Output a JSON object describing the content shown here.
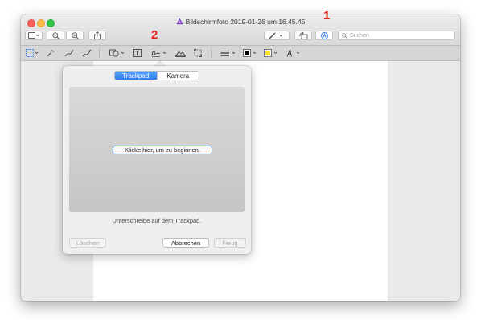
{
  "window": {
    "title": "Bildschirmfoto 2019-01-26 um 16.45.45"
  },
  "toolbar": {
    "search_placeholder": "Suchen"
  },
  "callouts": {
    "one": "1",
    "two": "2"
  },
  "signature_popover": {
    "tabs": [
      {
        "label": "Trackpad",
        "selected": true
      },
      {
        "label": "Kamera",
        "selected": false
      }
    ],
    "click_prompt": "Klicke hier, um zu beginnen.",
    "hint": "Unterschreibe auf dem Trackpad.",
    "buttons": {
      "clear": "Löschen",
      "cancel": "Abbrechen",
      "done": "Fertig"
    }
  },
  "colors": {
    "accent": "#2e7bf0",
    "callout": "#e8241b",
    "highlight_color": "#f5e62a",
    "stroke_color": "#000000"
  },
  "icons": [
    "sidebar-toggle-icon",
    "zoom-out-icon",
    "zoom-in-icon",
    "share-icon",
    "pen-icon",
    "rotate-icon",
    "markup-icon",
    "search-icon",
    "rectangular-selection-icon",
    "instant-alpha-icon",
    "sketch-icon",
    "draw-icon",
    "shapes-icon",
    "text-icon",
    "sign-icon",
    "adjust-color-icon",
    "adjust-size-icon",
    "shape-style-icon",
    "border-color-icon",
    "fill-color-icon",
    "text-style-icon"
  ]
}
